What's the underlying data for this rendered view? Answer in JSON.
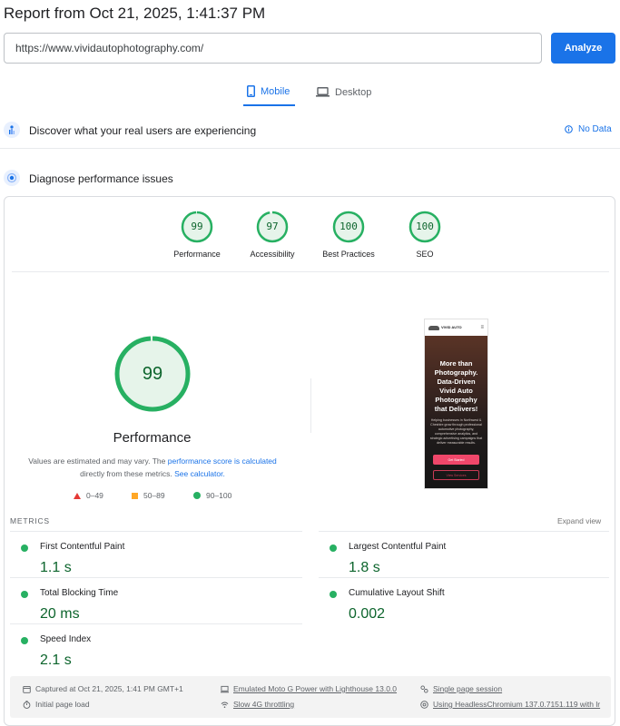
{
  "report": {
    "title": "Report from Oct 21, 2025, 1:41:37 PM"
  },
  "search": {
    "url_value": "https://www.vividautophotography.com/",
    "analyze_label": "Analyze"
  },
  "tabs": [
    {
      "label": "Mobile",
      "active": true
    },
    {
      "label": "Desktop",
      "active": false
    }
  ],
  "discover": {
    "text": "Discover what your real users are experiencing",
    "nodata_label": "No Data"
  },
  "diagnose": {
    "text": "Diagnose performance issues"
  },
  "scores": [
    {
      "label": "Performance",
      "score": "99",
      "fraction": 0.99
    },
    {
      "label": "Accessibility",
      "score": "97",
      "fraction": 0.97
    },
    {
      "label": "Best Practices",
      "score": "100",
      "fraction": 1.0
    },
    {
      "label": "SEO",
      "score": "100",
      "fraction": 1.0
    }
  ],
  "performance": {
    "score": "99",
    "fraction": 0.99,
    "label": "Performance",
    "note_prefix": "Values are estimated and may vary. The ",
    "note_link1": "performance score is calculated",
    "note_middle": " directly from these metrics. ",
    "note_link2": "See calculator."
  },
  "legend": [
    {
      "shape": "triangle",
      "range": "0–49",
      "color": "#e53935"
    },
    {
      "shape": "square",
      "range": "50–89",
      "color": "#ffa726"
    },
    {
      "shape": "circle",
      "range": "90–100",
      "color": "#27b062"
    }
  ],
  "screenshot": {
    "logo_text": "VIVID AUTO",
    "menu_icon": "hamburger-icon",
    "headline": "More than Photography. Data-Driven Vivid Auto Photography that Delivers!",
    "subtext": "Helping businesses in Northwest & Cheshire grow through professional automotive photography, comprehensive analytics, and strategic advertising campaigns that deliver measurable results.",
    "cta_primary": "Get Started",
    "cta_secondary": "View Services"
  },
  "metrics": {
    "heading": "METRICS",
    "expand_label": "Expand view",
    "items": [
      {
        "name": "First Contentful Paint",
        "value": "1.1 s"
      },
      {
        "name": "Largest Contentful Paint",
        "value": "1.8 s"
      },
      {
        "name": "Total Blocking Time",
        "value": "20 ms"
      },
      {
        "name": "Cumulative Layout Shift",
        "value": "0.002"
      },
      {
        "name": "Speed Index",
        "value": "2.1 s"
      }
    ]
  },
  "footer": {
    "captured": "Captured at Oct 21, 2025, 1:41 PM GMT+1",
    "emulated": "Emulated Moto G Power with Lighthouse 13.0.0",
    "session": "Single page session",
    "initial_load": "Initial page load",
    "throttling": "Slow 4G throttling",
    "browser": "Using HeadlessChromium 137.0.7151.119 with lr"
  },
  "colors": {
    "accent": "#1a73e8",
    "pass_green": "#0d652d",
    "pass_ring": "#27b062",
    "pass_fill": "#e6f4ea"
  }
}
